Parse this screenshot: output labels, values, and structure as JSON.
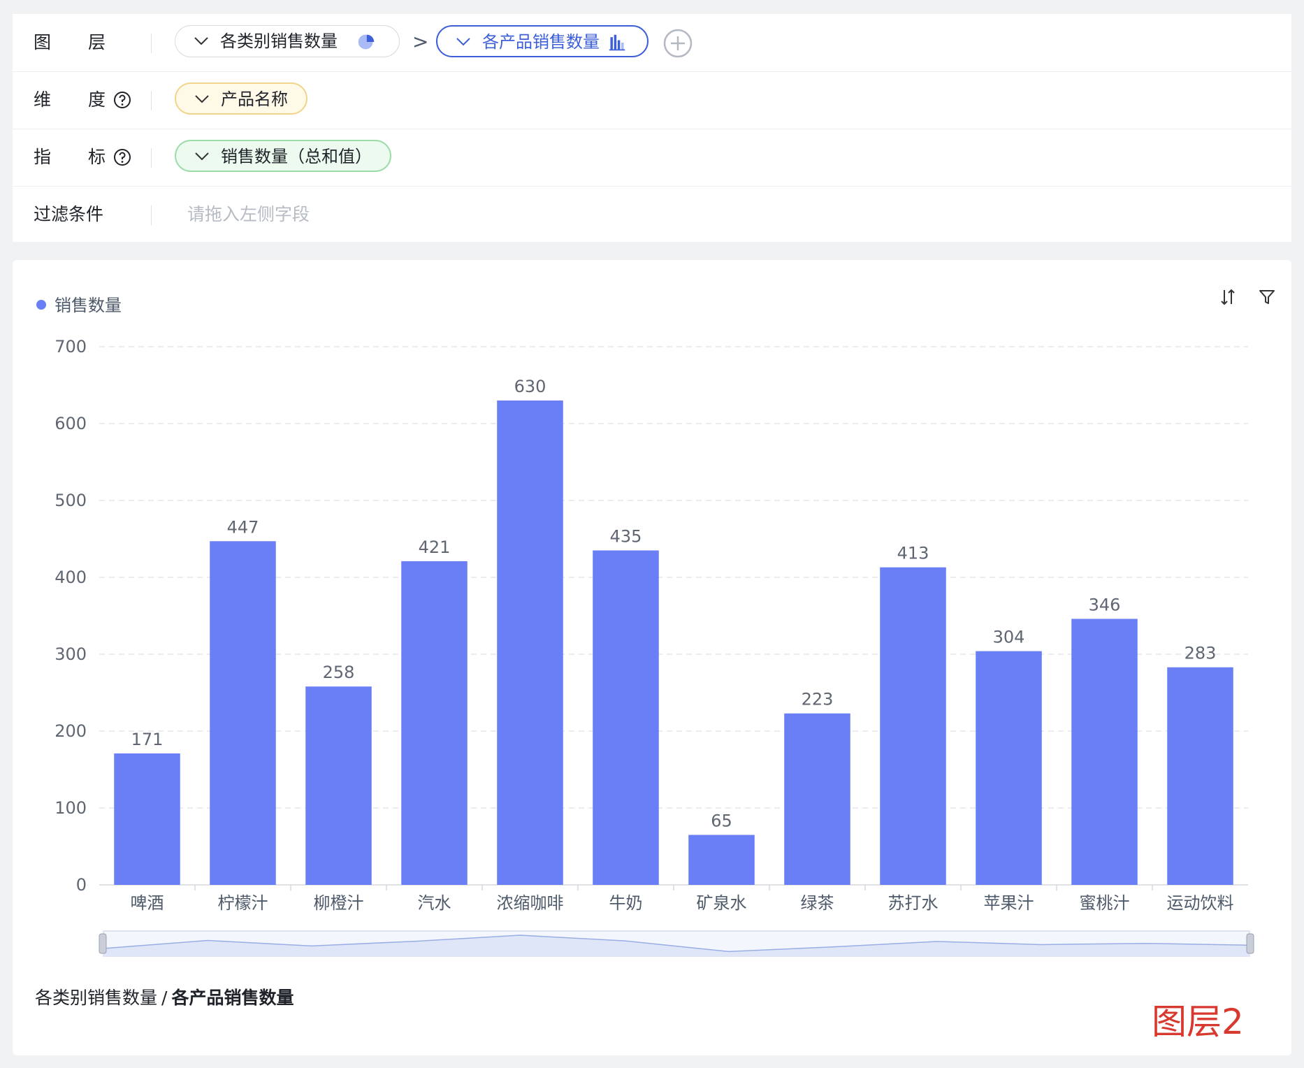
{
  "config": {
    "layer": {
      "label_c1": "图",
      "label_c2": "层",
      "layers": [
        {
          "name": "各类别销售数量",
          "icon": "pie-chart-icon"
        },
        {
          "name": "各产品销售数量",
          "icon": "bar-chart-icon"
        }
      ],
      "separator": ">"
    },
    "dimension": {
      "label_c1": "维",
      "label_c2": "度",
      "value": "产品名称"
    },
    "metric": {
      "label_c1": "指",
      "label_c2": "标",
      "value": "销售数量（总和值）"
    },
    "filter": {
      "label": "过滤条件",
      "placeholder": "请拖入左侧字段"
    }
  },
  "legend": {
    "label": "销售数量",
    "color": "#6a7ef5"
  },
  "toolbar": {
    "sort_icon": "sort-icon",
    "filter_icon": "filter-icon"
  },
  "chart_data": {
    "type": "bar",
    "categories": [
      "啤酒",
      "柠檬汁",
      "柳橙汁",
      "汽水",
      "浓缩咖啡",
      "牛奶",
      "矿泉水",
      "绿茶",
      "苏打水",
      "苹果汁",
      "蜜桃汁",
      "运动饮料"
    ],
    "series": [
      {
        "name": "销售数量",
        "values": [
          171,
          447,
          258,
          421,
          630,
          435,
          65,
          223,
          413,
          304,
          346,
          283
        ]
      }
    ],
    "yticks": [
      "0",
      "100",
      "200",
      "300",
      "400",
      "500",
      "600",
      "700"
    ],
    "ylim": [
      0,
      700
    ],
    "grid": true,
    "legend": "top-left",
    "bar_color": "#6a7ef5"
  },
  "breadcrumb": {
    "parent": "各类别销售数量",
    "separator": "/",
    "current": "各产品销售数量"
  },
  "stamp": "图层2"
}
